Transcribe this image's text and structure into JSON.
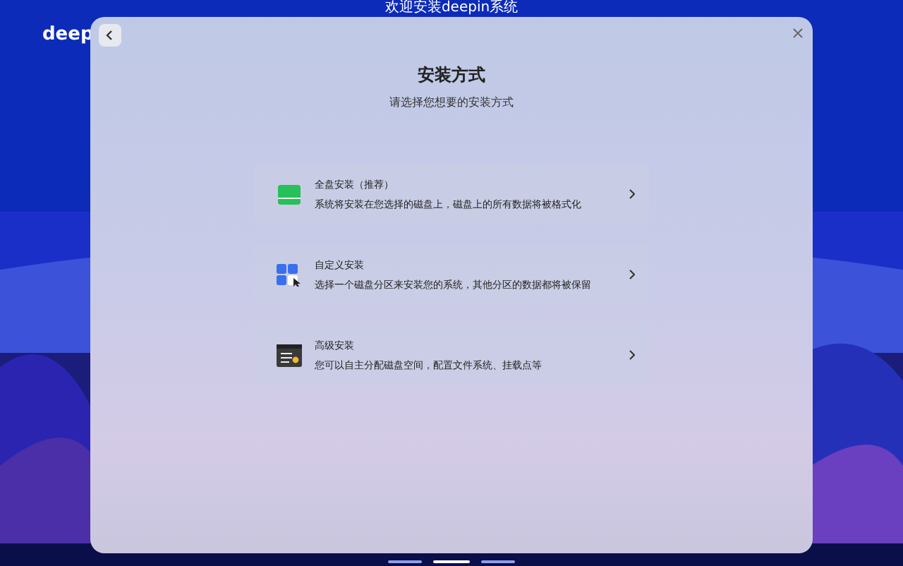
{
  "desktop": {
    "title": "欢迎安装deepin系统",
    "logo": "deep"
  },
  "dialog": {
    "title": "安装方式",
    "subtitle": "请选择您想要的安装方式"
  },
  "options": [
    {
      "kind": "full",
      "title": "全盘安装（推荐）",
      "description": "系统将安装在您选择的磁盘上，磁盘上的所有数据将被格式化"
    },
    {
      "kind": "custom",
      "title": "自定义安装",
      "description": "选择一个磁盘分区来安装您的系统，其他分区的数据都将被保留"
    },
    {
      "kind": "advanced",
      "title": "高级安装",
      "description": "您可以自主分配磁盘空间，配置文件系统、挂载点等"
    }
  ],
  "pages": [
    {
      "selected": false
    },
    {
      "selected": true
    },
    {
      "selected": false
    }
  ]
}
